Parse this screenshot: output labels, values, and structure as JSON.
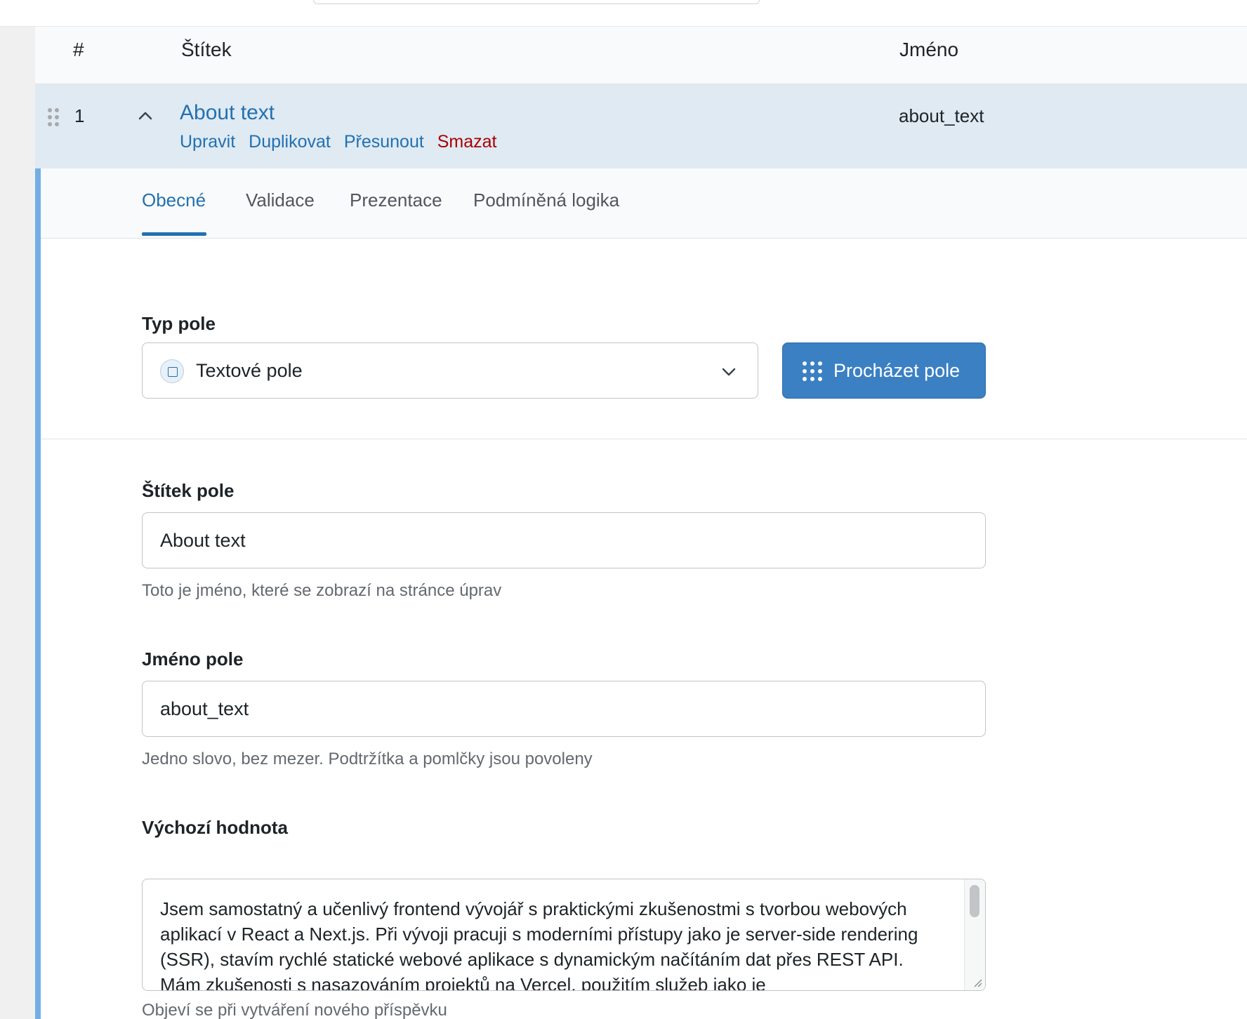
{
  "table": {
    "headers": {
      "num": "#",
      "label": "Štítek",
      "name": "Jméno"
    }
  },
  "field": {
    "index": "1",
    "label": "About text",
    "name": "about_text",
    "actions": [
      {
        "label": "Upravit"
      },
      {
        "label": "Duplikovat"
      },
      {
        "label": "Přesunout"
      },
      {
        "label": "Smazat"
      }
    ]
  },
  "tabs": [
    {
      "label": "Obecné",
      "active": true
    },
    {
      "label": "Validace",
      "active": false
    },
    {
      "label": "Prezentace",
      "active": false
    },
    {
      "label": "Podmíněná logika",
      "active": false
    }
  ],
  "settings": {
    "field_type": {
      "label": "Typ pole",
      "value": "Textové pole",
      "icon": "text-field-icon",
      "browse_button": "Procházet pole"
    },
    "field_label": {
      "label": "Štítek pole",
      "value": "About text",
      "help": "Toto je jméno, které se zobrazí na stránce úprav"
    },
    "field_name": {
      "label": "Jméno pole",
      "value": "about_text",
      "help": "Jedno slovo, bez mezer. Podtržítka a pomlčky jsou povoleny"
    },
    "default_value": {
      "label": "Výchozí hodnota",
      "value": "Jsem samostatný a učenlivý frontend vývojář s praktickými zkušenostmi s tvorbou webových aplikací v React a Next.js. Při vývoji pracuji s moderními přístupy jako je server-side rendering (SSR), stavím rychlé statické webové aplikace s dynamickým načítáním dat přes REST API. Mám zkušenosti s nasazováním projektů na Vercel, použitím služeb jako je",
      "help": "Objeví se při vytváření nového příspěvku"
    }
  },
  "colors": {
    "accent": "#2271b1",
    "row_highlight": "#dfeaf3",
    "danger": "#aa0000",
    "panel_border": "#72aee6",
    "button": "#3a80c3"
  }
}
